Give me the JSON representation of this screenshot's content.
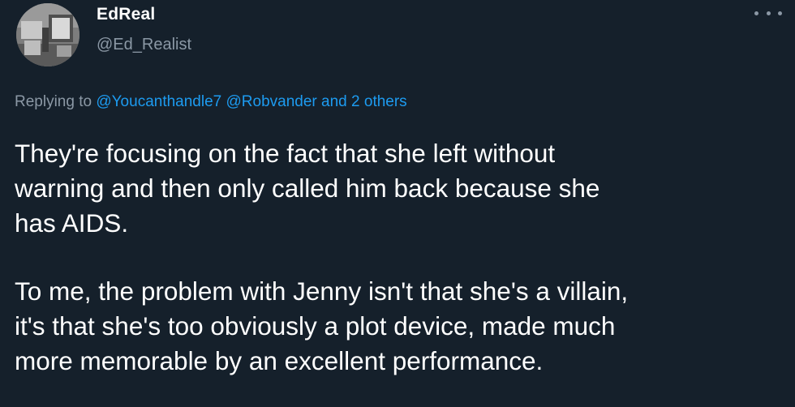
{
  "author": {
    "display_name": "EdReal",
    "handle": "@Ed_Realist",
    "avatar_icon": "avatar-photo"
  },
  "menu": {
    "icon": "more-options-icon"
  },
  "reply": {
    "prefix": "Replying to",
    "mention1": "@Youcanthandle7",
    "mention2": "@Robvander",
    "suffix": "and 2 others"
  },
  "tweet": {
    "paragraph1_line1": "They're focusing on the fact that she left without",
    "paragraph1_line2": "warning and then only called him back because she",
    "paragraph1_line3": "has AIDS.",
    "paragraph2_line1": "To me, the problem with Jenny isn't that she's a villain,",
    "paragraph2_line2": "it's that she's too obviously a plot device, made much",
    "paragraph2_line3": "more memorable by an excellent performance."
  },
  "colors": {
    "background": "#15202b",
    "text": "#ffffff",
    "secondary_text": "#8b98a5",
    "link": "#1d9bf0"
  }
}
